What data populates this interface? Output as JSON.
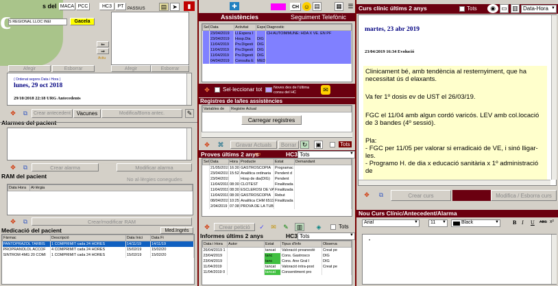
{
  "left": {
    "title_frag": "s del",
    "tab_maca": "MACA",
    "tab_pcc": "PCC",
    "tab_hc3": "HC3",
    "tab_pt": "PT",
    "passius": "PASSIUS",
    "regional": "S REGIONAL LLOC INEI",
    "gacela": "Gacela",
    "afegir1": "Afegir",
    "esborrar1": "Esborrar",
    "afegir2": "Afegir",
    "esborrar2": "Esborrar",
    "actiu": "Actiu",
    "order_note": "( Ordenat segons Data i Hora )",
    "date_main": "lunes, 29 oct 2018",
    "entry": "29/10/2018 22:18 URG  Antecedents",
    "crear_antecedent": "Crear antecedent",
    "vacunes": "Vacunes",
    "modifica_antec": "Modifica/Borra antec.",
    "alarmes_title": "Alarmes del pacient",
    "crear_alarma": "Crear alarma",
    "modificar_alarma": "Modificar alarma",
    "ram_title": "RAM del pacient",
    "ram_note": "No al·lèrgies conegudes",
    "ram_cols": [
      "Data Hora",
      "Al·lèrgia"
    ],
    "crear_ram": "Crear/modificar RAM",
    "med_title": "Medicació del pacient",
    "med_ingres": "Med.Ingrés",
    "med_cols": [
      "Fàrmac",
      "Descripció",
      "Data Inici",
      "Data Fi"
    ],
    "med_rows": [
      [
        "PANTOPRAZOL TARBIS",
        "1 COMPRIMIT cada 24 HORES",
        "14/11/19",
        "14/11/19"
      ],
      [
        "PROPRANOLOL ACCOF",
        "4 COMPRIMIT cada 24 HORES",
        "15/02/19",
        "15/02/20"
      ],
      [
        "SINTROM 4MG 20 COMI",
        "1 COMPRIMIT cada 24 HORES",
        "15/02/19",
        "15/02/20"
      ]
    ]
  },
  "middle": {
    "tab_assist": "Assistències",
    "tab_seg": "Seguiment Telefònic",
    "ch_label": "CH",
    "assist_cols": [
      "Sel",
      "Data",
      "Activitat",
      "Espe",
      "Diagnostic"
    ],
    "assist_rows": [
      [
        "",
        "23/04/2019",
        "Ll.Espera I",
        "",
        "CH AUTOIMMUNE: HDA X VE. EN PF"
      ],
      [
        "",
        "23/04/2019",
        "Hosp.Dia",
        "DIG",
        ""
      ],
      [
        "",
        "11/04/2019",
        "Prv.Digesti",
        "DIG",
        ""
      ],
      [
        "",
        "11/04/2019",
        "Prv.Digesti",
        "DIG",
        ""
      ],
      [
        "",
        "11/04/2019",
        "Prv.Digesti",
        "DIG",
        ""
      ],
      [
        "",
        "04/04/2019",
        "Consulta E",
        "MED",
        ""
      ]
    ],
    "select_all": "Sel·leccionar tot",
    "noves_des": "Noves des de l'última consu del HC",
    "registres_title": "Registres de la/les assistències",
    "reg_cols": [
      "Variables de",
      "Registre Actual"
    ],
    "carregar": "Carregar registres",
    "gravar": "Gravar Actuals",
    "borrar": "Borrar",
    "tots": "Tots",
    "proves_title": "Proves últims 2 anys",
    "hc3": "HC3",
    "tots_select": "Tots",
    "proves_cols": [
      "Sel",
      "Data",
      "Hora",
      "Producte",
      "Estat",
      "Demandant"
    ],
    "proves_rows": [
      [
        "",
        "21/05/2019",
        "16:30",
        "GASTROSCOPIA",
        "Programac"
      ],
      [
        "",
        "23/04/2019",
        "15:52",
        "Analítica ordinaria",
        "Pendent d"
      ],
      [
        "",
        "23/04/2019",
        "",
        "Hosp de dia(DIG)",
        "Pendent"
      ],
      [
        "",
        "11/04/2019",
        "08:30",
        "CLOTEST",
        "Finalitzada"
      ],
      [
        "",
        "11/04/2019",
        "08:30",
        "ESCLEROSI DE VAR",
        "Finalitzada"
      ],
      [
        "",
        "11/04/2019",
        "08:30",
        "GASTROSCOPIA",
        "Rebut"
      ],
      [
        "",
        "08/04/2019",
        "10:25",
        "Analítica CHM 65111",
        "Finalitzada"
      ],
      [
        "",
        "2/04/2019",
        "07:38",
        "PROVA DE LA TUBEI",
        ""
      ]
    ],
    "crear_peticio": "Crear petició",
    "informes_title": "Informes últims 2 anys",
    "informes_cols": [
      "Data i Hora",
      "Autor",
      "Estat",
      "Tipus d'Info",
      "Observa"
    ],
    "informes_rows": [
      [
        "26/04/2019 1",
        "",
        "tancat",
        "Valoració preanestè",
        "Creat pe"
      ],
      [
        "23/04/2019",
        "",
        "tanc",
        "Cons. Gastrosco",
        "DIG"
      ],
      [
        "23/04/2019",
        "",
        "tanc",
        "Cons. Ane Gral I",
        "DIG"
      ],
      [
        "11/04/2019",
        "",
        "tancat",
        "Valoració intra-post",
        "Creat pe"
      ],
      [
        "11/04/2019 0",
        "",
        "tancat",
        "Consentiment pro",
        ""
      ]
    ]
  },
  "right": {
    "curs_title": "Curs clínic últims 2 anys",
    "tots": "Tots",
    "sort": "Data-Hora",
    "date_header": "martes, 23 abr 2019",
    "entry_header": "23/04/2019 16:34 Evolució",
    "note_lines": [
      "Clinicament bé, amb tendència al resternyiment, que ha necessitat ús d elaxants.",
      "Va fer 1º dosis ev de UST el 26/03/19.",
      "FGC el 11/04 amb algun cordó varicós. LEV amb col.locació de 3 bandes (4º sessió).",
      "Pla:",
      "- FGC per 11/05 per valorar si erradicaió de VE, i sinó lligar-les.",
      "- Programo H. de dia x educació sanitària x 1º administració de"
    ],
    "crear_curs": "Crear curs",
    "modifica_curs": "Modifica / Esborra curs",
    "nou_title": "Nou Curs Clínic/Antecedent/Alarma",
    "font": "Arial",
    "size": "11",
    "color": "Black",
    "bold": "B",
    "italic": "I",
    "underline": "U",
    "strike": "ABE"
  },
  "colors": {
    "maroon": "#7a0000",
    "selected_row": "#1060c0",
    "purple_row": "#8080ff",
    "yellow_note": "#ffffcc",
    "green_header": "#a9c48a"
  }
}
